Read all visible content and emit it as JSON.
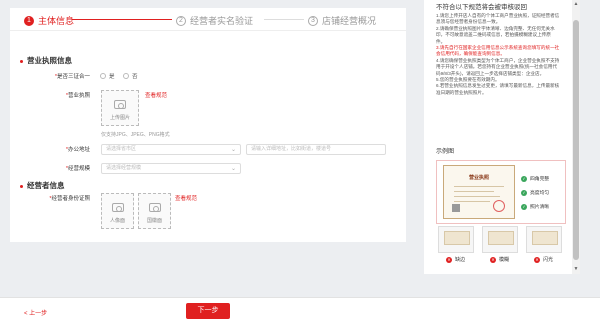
{
  "steps": [
    {
      "num": "1",
      "label": "主体信息"
    },
    {
      "num": "2",
      "label": "经营者实名验证"
    },
    {
      "num": "3",
      "label": "店铺经营概况"
    }
  ],
  "license_section": {
    "title": "营业执照信息",
    "unified_label": "是否三证合一",
    "radio_yes": "是",
    "radio_no": "否",
    "license_label": "营业执照",
    "upload_text": "上传图片",
    "view_spec": "查看规范",
    "format_hint": "仅支持JPG、JPEG、PNG格式",
    "address_label": "办公地址",
    "region_placeholder": "请选择省市区",
    "detail_placeholder": "请输入详细地址，比如街道，楼道号",
    "scale_label": "经营规模",
    "scale_placeholder": "请选择经营规模"
  },
  "operator_section": {
    "title": "经营者信息",
    "id_label": "经营者身份证照",
    "front_label": "人像面",
    "back_label": "国徽面",
    "view_spec": "查看规范"
  },
  "footer": {
    "prev": "< 上一步",
    "next": "下一步"
  },
  "side": {
    "heading": "不符合以下规范将会被审核驳回",
    "tips": [
      {
        "text": "1.请您上传开店人自有的个体工商户营业执照，证照经营者信息须与您经营者身份信息一致。",
        "red": false
      },
      {
        "text": "2.请确保营业执照图片字体清晰、边角完整、无任何无关水印，不可故意遮盖二维码或信息，若拍摄模糊建议上传原件。",
        "red": false
      },
      {
        "text": "3.请先自行在国家企业信用信息公示系统查询您填写的统一社会信用代码，确保能查询到信息。",
        "red": true
      },
      {
        "text": "4.请您确保营业执照类型为个体工商户，企业营业执照不支持用于开设个人店铺。若您持有企业营业执照(统一社会信用代码9/8/3开头)，请返回上一步选择店铺类型：企业店。",
        "red": false
      },
      {
        "text": "5.您的营业执照要在有效期内。",
        "red": false
      },
      {
        "text": "6.若营业执照信息发生过变更，请填写最新信息，上传最新核准日期的营业执照照片。",
        "red": false
      }
    ],
    "example_title": "示例图",
    "license_title": "营业执照",
    "checks": [
      "四角完整",
      "亮度均匀",
      "照片清晰"
    ],
    "bad_examples": [
      "缺边",
      "模糊",
      "闪光"
    ]
  },
  "colors": {
    "accent": "#e02020",
    "ok": "#3aa65c"
  }
}
